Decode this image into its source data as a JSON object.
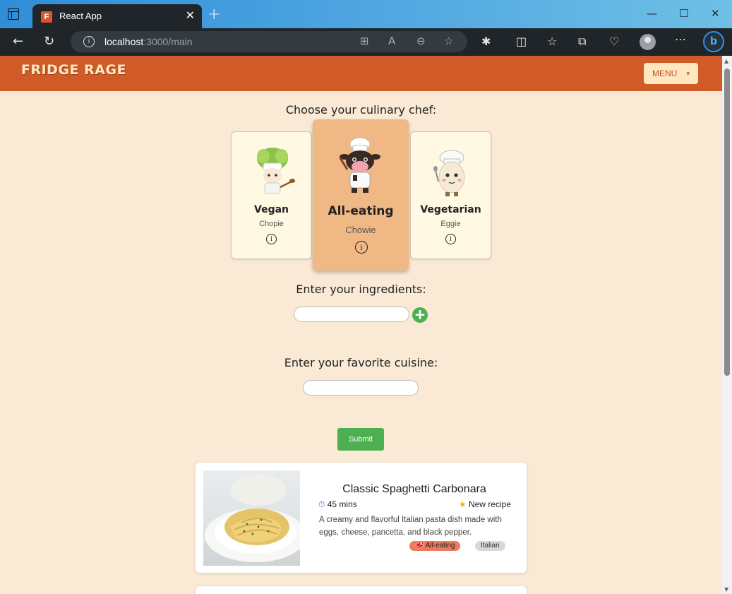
{
  "browser": {
    "tab_title": "React App",
    "favicon_letter": "F",
    "url_host": "localhost",
    "url_path": ":3000/main"
  },
  "app": {
    "logo_text": "FRIDGE RAGE",
    "menu_label": "MENU",
    "brand_color": "#d05a28",
    "background_color": "#faead5"
  },
  "chef_section": {
    "title": "Choose your culinary chef:",
    "chefs": [
      {
        "name": "Vegan",
        "nickname": "Chopie",
        "selected": false,
        "icon": "lettuce-chef-icon"
      },
      {
        "name": "All-eating",
        "nickname": "Chowie",
        "selected": true,
        "icon": "cow-chef-icon"
      },
      {
        "name": "Vegetarian",
        "nickname": "Eggie",
        "selected": false,
        "icon": "egg-chef-icon"
      }
    ]
  },
  "ingredients": {
    "label": "Enter your ingredients:",
    "value": ""
  },
  "cuisine": {
    "label": "Enter your favorite cuisine:",
    "value": ""
  },
  "submit_label": "Submit",
  "recipes": [
    {
      "title": "Classic Spaghetti Carbonara",
      "time": "45 mins",
      "status": "New recipe",
      "description": "A creamy and flavorful Italian pasta dish made with eggs, cheese, pancetta, and black pepper.",
      "tags": [
        "All-eating",
        "Italian"
      ]
    }
  ]
}
